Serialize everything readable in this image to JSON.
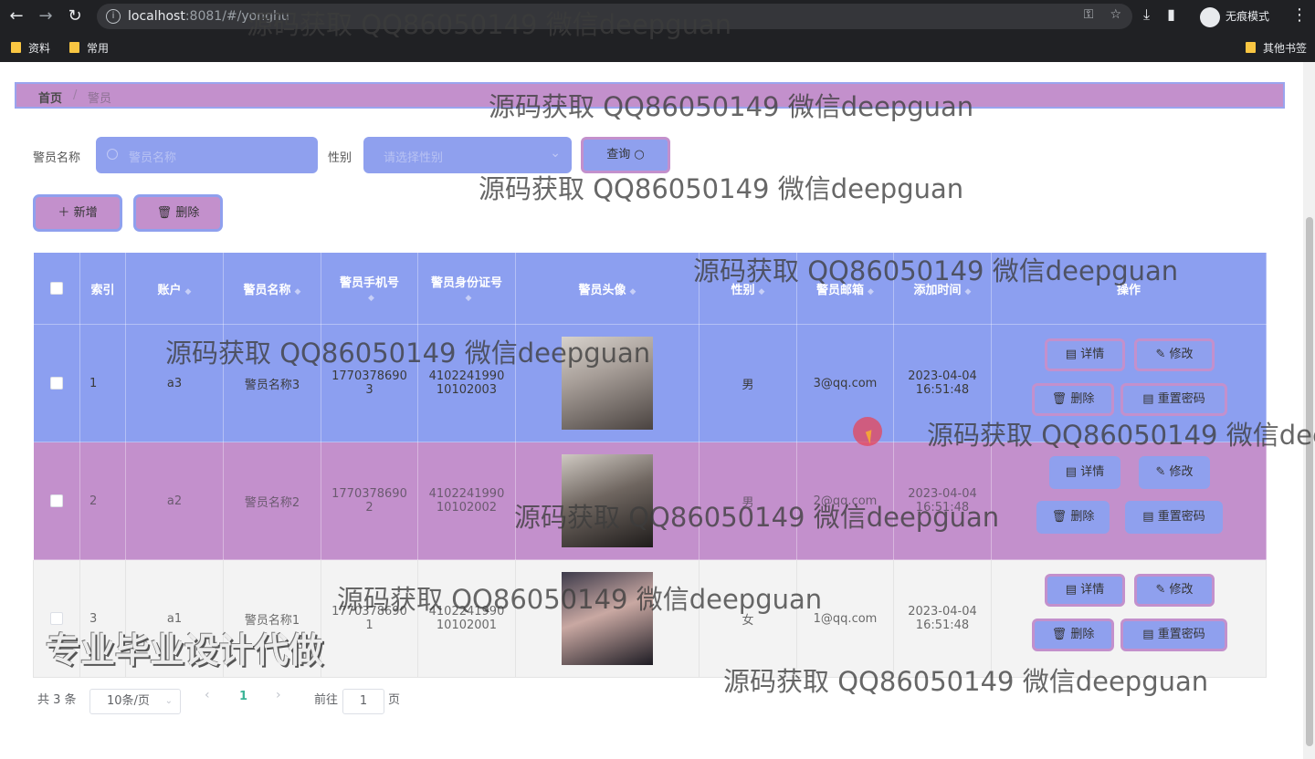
{
  "browser": {
    "url_host": "localhost",
    "url_rest": ":8081/#/yonghu",
    "incognito_label": "无痕模式",
    "bookmarks": [
      "资料",
      "常用"
    ],
    "other_bookmarks": "其他书签"
  },
  "breadcrumb": {
    "home": "首页",
    "separator": "/",
    "current": "警员"
  },
  "search": {
    "name_label": "警员名称",
    "name_placeholder": "警员名称",
    "gender_label": "性别",
    "gender_placeholder": "请选择性别",
    "query_label": "查询"
  },
  "actions": {
    "add_label": "新增",
    "delete_label": "删除"
  },
  "table": {
    "headers": {
      "index": "索引",
      "account": "账户",
      "name": "警员名称",
      "phone": "警员手机号",
      "idcard": "警员身份证号",
      "avatar": "警员头像",
      "gender": "性别",
      "email": "警员邮箱",
      "created": "添加时间",
      "ops": "操作"
    },
    "rows": [
      {
        "index": "1",
        "account": "a3",
        "name": "警员名称3",
        "phone_1": "1770378690",
        "phone_2": "3",
        "idcard_1": "4102241990",
        "idcard_2": "10102003",
        "gender": "男",
        "email": "3@qq.com",
        "date": "2023-04-04",
        "time": "16:51:48"
      },
      {
        "index": "2",
        "account": "a2",
        "name": "警员名称2",
        "phone_1": "1770378690",
        "phone_2": "2",
        "idcard_1": "4102241990",
        "idcard_2": "10102002",
        "gender": "男",
        "email": "2@qq.com",
        "date": "2023-04-04",
        "time": "16:51:48"
      },
      {
        "index": "3",
        "account": "a1",
        "name": "警员名称1",
        "phone_1": "1770378690",
        "phone_2": "1",
        "idcard_1": "4102241990",
        "idcard_2": "10102001",
        "gender": "女",
        "email": "1@qq.com",
        "date": "2023-04-04",
        "time": "16:51:48"
      }
    ],
    "op_labels": {
      "detail": "详情",
      "edit": "修改",
      "delete": "删除",
      "reset": "重置密码"
    }
  },
  "pagination": {
    "total": "共 3 条",
    "page_size": "10条/页",
    "current_page": "1",
    "goto_prefix": "前往",
    "goto_value": "1",
    "goto_suffix": "页"
  },
  "overlay": {
    "watermark": "源码获取 QQ86050149 微信deepguan",
    "stamp": "专业毕业设计代做"
  },
  "colors": {
    "primary": "#8c9ff0",
    "secondary": "#c390cc",
    "accent": "#3cb497"
  }
}
